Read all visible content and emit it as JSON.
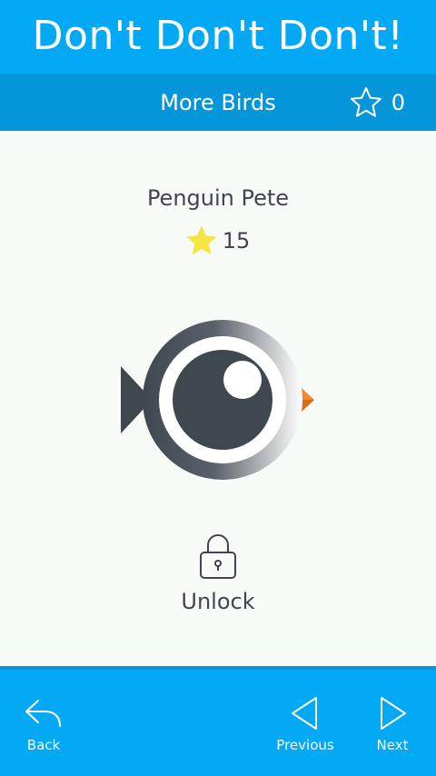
{
  "app": {
    "title": "Don't Don't Don't!"
  },
  "header": {
    "section_title": "More Birds",
    "star_count": "0"
  },
  "bird": {
    "name": "Penguin Pete",
    "cost": "15"
  },
  "unlock": {
    "label": "Unlock"
  },
  "nav": {
    "back_label": "Back",
    "previous_label": "Previous",
    "next_label": "Next"
  },
  "colors": {
    "primary": "#03a9f4",
    "primary_dark": "#0496d9",
    "background": "#f7fbf8",
    "text": "#3e4650",
    "star": "#f4e542",
    "beak": "#f08a2c"
  },
  "icons": {
    "star_outline": "star-outline-icon",
    "star_filled": "star-filled-icon",
    "lock": "lock-icon",
    "back": "reply-arrow-icon",
    "previous": "triangle-left-icon",
    "next": "triangle-right-icon"
  }
}
